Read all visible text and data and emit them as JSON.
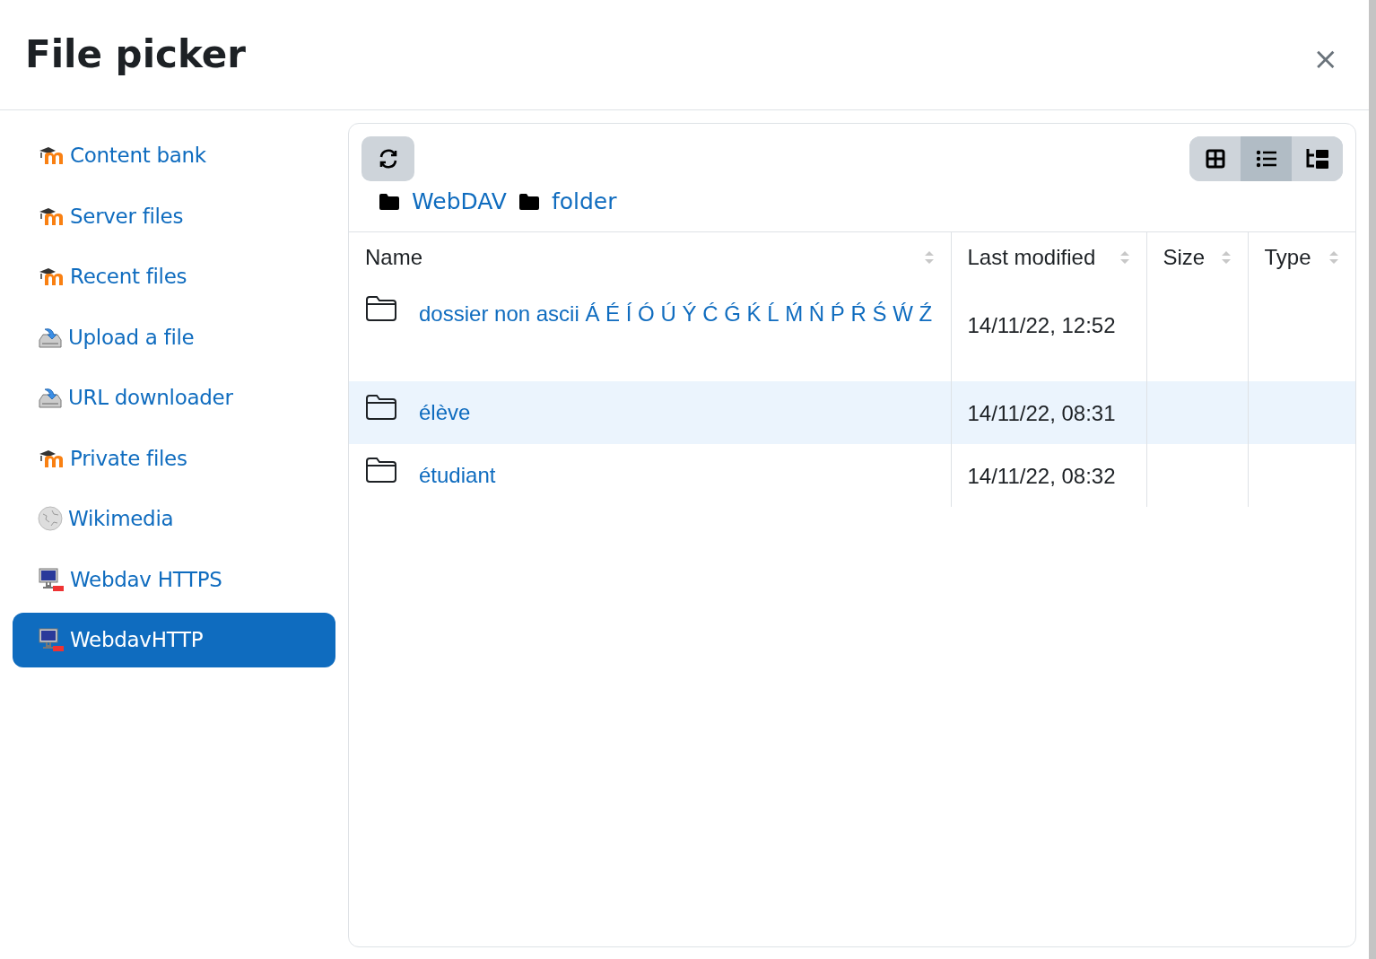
{
  "dialog": {
    "title": "File picker",
    "close": "×"
  },
  "sidebar": {
    "items": [
      {
        "label": "Content bank",
        "kind": "moodle",
        "selected": false
      },
      {
        "label": "Server files",
        "kind": "moodle",
        "selected": false
      },
      {
        "label": "Recent files",
        "kind": "moodle",
        "selected": false
      },
      {
        "label": "Upload a file",
        "kind": "upload",
        "selected": false
      },
      {
        "label": "URL downloader",
        "kind": "upload",
        "selected": false
      },
      {
        "label": "Private files",
        "kind": "moodle",
        "selected": false
      },
      {
        "label": "Wikimedia",
        "kind": "wikimedia",
        "selected": false
      },
      {
        "label": "Webdav HTTPS",
        "kind": "webdav",
        "selected": false
      },
      {
        "label": "WebdavHTTP",
        "kind": "webdav",
        "selected": true
      }
    ]
  },
  "toolbar": {
    "views": [
      {
        "kind": "grid",
        "selected": false
      },
      {
        "kind": "list",
        "selected": true
      },
      {
        "kind": "tree",
        "selected": false
      }
    ]
  },
  "breadcrumb": [
    "WebDAV",
    "folder"
  ],
  "table": {
    "columns": [
      "Name",
      "Last modified",
      "Size",
      "Type"
    ],
    "rows": [
      {
        "name": "dossier non ascii Á É Í Ó Ú Ý Ć Ǵ Ḱ Ĺ Ḿ Ń Ṕ Ŕ Ś Ẃ Ź",
        "modified": "14/11/22, 12:52",
        "selected": false
      },
      {
        "name": "élève",
        "modified": "14/11/22, 08:31",
        "selected": true
      },
      {
        "name": "étudiant",
        "modified": "14/11/22, 08:32",
        "selected": false
      }
    ]
  }
}
